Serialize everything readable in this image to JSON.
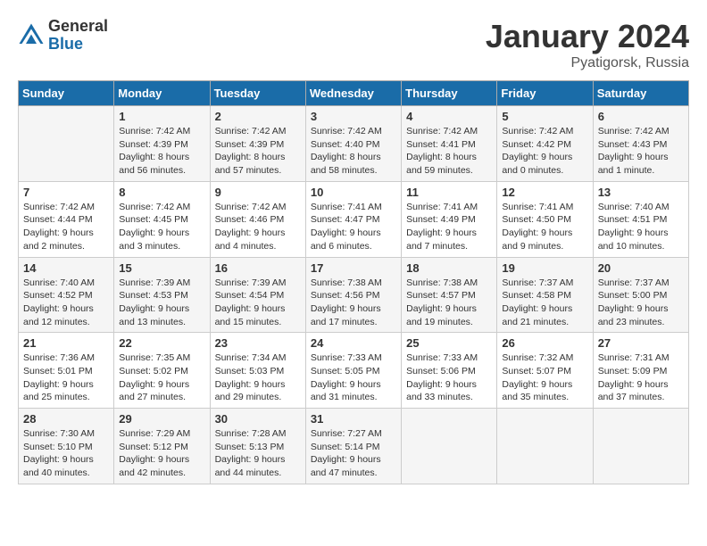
{
  "header": {
    "logo_general": "General",
    "logo_blue": "Blue",
    "title": "January 2024",
    "location": "Pyatigorsk, Russia"
  },
  "days_of_week": [
    "Sunday",
    "Monday",
    "Tuesday",
    "Wednesday",
    "Thursday",
    "Friday",
    "Saturday"
  ],
  "weeks": [
    [
      {
        "day": "",
        "info": ""
      },
      {
        "day": "1",
        "info": "Sunrise: 7:42 AM\nSunset: 4:39 PM\nDaylight: 8 hours\nand 56 minutes."
      },
      {
        "day": "2",
        "info": "Sunrise: 7:42 AM\nSunset: 4:39 PM\nDaylight: 8 hours\nand 57 minutes."
      },
      {
        "day": "3",
        "info": "Sunrise: 7:42 AM\nSunset: 4:40 PM\nDaylight: 8 hours\nand 58 minutes."
      },
      {
        "day": "4",
        "info": "Sunrise: 7:42 AM\nSunset: 4:41 PM\nDaylight: 8 hours\nand 59 minutes."
      },
      {
        "day": "5",
        "info": "Sunrise: 7:42 AM\nSunset: 4:42 PM\nDaylight: 9 hours\nand 0 minutes."
      },
      {
        "day": "6",
        "info": "Sunrise: 7:42 AM\nSunset: 4:43 PM\nDaylight: 9 hours\nand 1 minute."
      }
    ],
    [
      {
        "day": "7",
        "info": "Sunrise: 7:42 AM\nSunset: 4:44 PM\nDaylight: 9 hours\nand 2 minutes."
      },
      {
        "day": "8",
        "info": "Sunrise: 7:42 AM\nSunset: 4:45 PM\nDaylight: 9 hours\nand 3 minutes."
      },
      {
        "day": "9",
        "info": "Sunrise: 7:42 AM\nSunset: 4:46 PM\nDaylight: 9 hours\nand 4 minutes."
      },
      {
        "day": "10",
        "info": "Sunrise: 7:41 AM\nSunset: 4:47 PM\nDaylight: 9 hours\nand 6 minutes."
      },
      {
        "day": "11",
        "info": "Sunrise: 7:41 AM\nSunset: 4:49 PM\nDaylight: 9 hours\nand 7 minutes."
      },
      {
        "day": "12",
        "info": "Sunrise: 7:41 AM\nSunset: 4:50 PM\nDaylight: 9 hours\nand 9 minutes."
      },
      {
        "day": "13",
        "info": "Sunrise: 7:40 AM\nSunset: 4:51 PM\nDaylight: 9 hours\nand 10 minutes."
      }
    ],
    [
      {
        "day": "14",
        "info": "Sunrise: 7:40 AM\nSunset: 4:52 PM\nDaylight: 9 hours\nand 12 minutes."
      },
      {
        "day": "15",
        "info": "Sunrise: 7:39 AM\nSunset: 4:53 PM\nDaylight: 9 hours\nand 13 minutes."
      },
      {
        "day": "16",
        "info": "Sunrise: 7:39 AM\nSunset: 4:54 PM\nDaylight: 9 hours\nand 15 minutes."
      },
      {
        "day": "17",
        "info": "Sunrise: 7:38 AM\nSunset: 4:56 PM\nDaylight: 9 hours\nand 17 minutes."
      },
      {
        "day": "18",
        "info": "Sunrise: 7:38 AM\nSunset: 4:57 PM\nDaylight: 9 hours\nand 19 minutes."
      },
      {
        "day": "19",
        "info": "Sunrise: 7:37 AM\nSunset: 4:58 PM\nDaylight: 9 hours\nand 21 minutes."
      },
      {
        "day": "20",
        "info": "Sunrise: 7:37 AM\nSunset: 5:00 PM\nDaylight: 9 hours\nand 23 minutes."
      }
    ],
    [
      {
        "day": "21",
        "info": "Sunrise: 7:36 AM\nSunset: 5:01 PM\nDaylight: 9 hours\nand 25 minutes."
      },
      {
        "day": "22",
        "info": "Sunrise: 7:35 AM\nSunset: 5:02 PM\nDaylight: 9 hours\nand 27 minutes."
      },
      {
        "day": "23",
        "info": "Sunrise: 7:34 AM\nSunset: 5:03 PM\nDaylight: 9 hours\nand 29 minutes."
      },
      {
        "day": "24",
        "info": "Sunrise: 7:33 AM\nSunset: 5:05 PM\nDaylight: 9 hours\nand 31 minutes."
      },
      {
        "day": "25",
        "info": "Sunrise: 7:33 AM\nSunset: 5:06 PM\nDaylight: 9 hours\nand 33 minutes."
      },
      {
        "day": "26",
        "info": "Sunrise: 7:32 AM\nSunset: 5:07 PM\nDaylight: 9 hours\nand 35 minutes."
      },
      {
        "day": "27",
        "info": "Sunrise: 7:31 AM\nSunset: 5:09 PM\nDaylight: 9 hours\nand 37 minutes."
      }
    ],
    [
      {
        "day": "28",
        "info": "Sunrise: 7:30 AM\nSunset: 5:10 PM\nDaylight: 9 hours\nand 40 minutes."
      },
      {
        "day": "29",
        "info": "Sunrise: 7:29 AM\nSunset: 5:12 PM\nDaylight: 9 hours\nand 42 minutes."
      },
      {
        "day": "30",
        "info": "Sunrise: 7:28 AM\nSunset: 5:13 PM\nDaylight: 9 hours\nand 44 minutes."
      },
      {
        "day": "31",
        "info": "Sunrise: 7:27 AM\nSunset: 5:14 PM\nDaylight: 9 hours\nand 47 minutes."
      },
      {
        "day": "",
        "info": ""
      },
      {
        "day": "",
        "info": ""
      },
      {
        "day": "",
        "info": ""
      }
    ]
  ]
}
